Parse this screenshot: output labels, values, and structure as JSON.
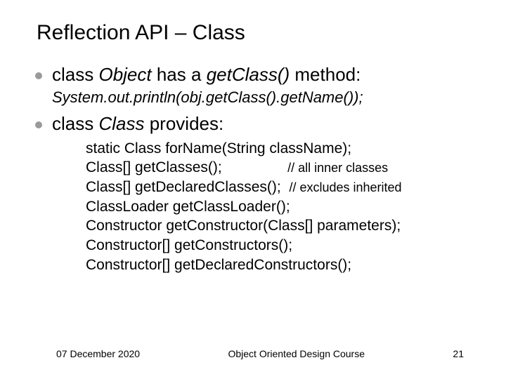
{
  "title": "Reflection API – Class",
  "bullet1": {
    "prefix": "class ",
    "italic1": "Object",
    "mid": " has a ",
    "italic2": "getClass()",
    "suffix": " method:"
  },
  "subline": "System.out.println(obj.getClass().getName());",
  "bullet2": {
    "prefix": "class ",
    "italic": "Class",
    "suffix": " provides:"
  },
  "code": {
    "l1": "static Class forName(String className);",
    "l2a": "Class[] getClasses();",
    "l2b": "// all inner classes",
    "l3a": "Class[] getDeclaredClasses();",
    "l3b": "// excludes inherited",
    "l4": "ClassLoader getClassLoader();",
    "l5": "Constructor getConstructor(Class[] parameters);",
    "l6": "Constructor[] getConstructors();",
    "l7": "Constructor[] getDeclaredConstructors();"
  },
  "footer": {
    "date": "07 December 2020",
    "course": "Object Oriented Design Course",
    "page": "21"
  }
}
